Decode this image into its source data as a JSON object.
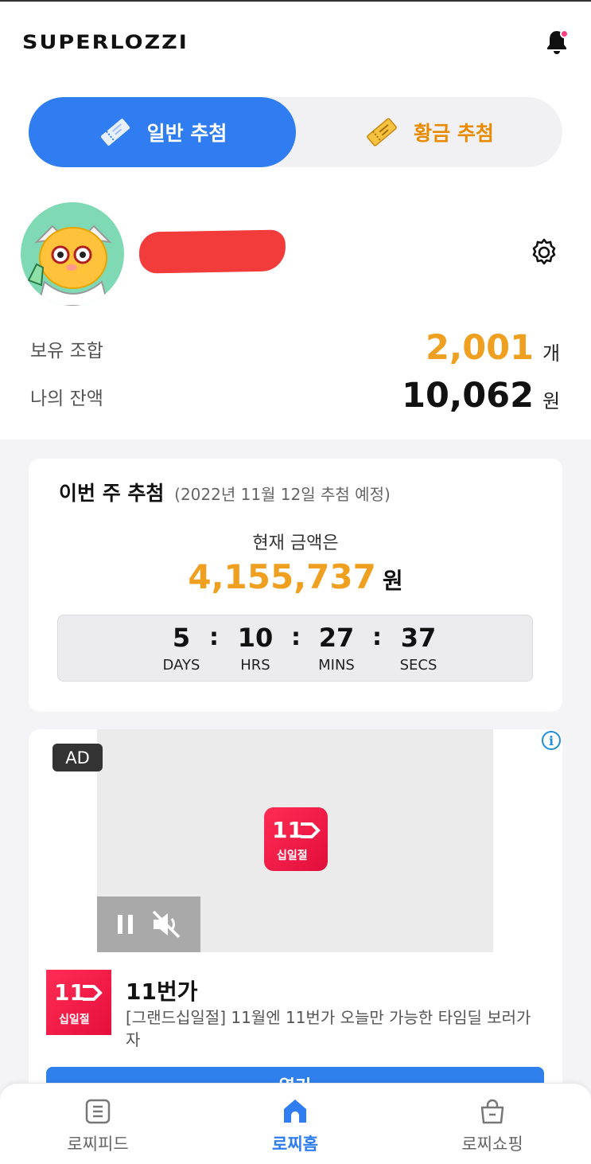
{
  "header": {
    "logo_text": "SUPERLOZZI"
  },
  "tabs": {
    "normal_label": "일반 추첨",
    "gold_label": "황금 추첨"
  },
  "stats": {
    "combos_label": "보유 조합",
    "combos_value": "2,001",
    "combos_unit": "개",
    "balance_label": "나의 잔액",
    "balance_value": "10,062",
    "balance_unit": "원"
  },
  "draw": {
    "title": "이번 주 추첨",
    "subtitle": "(2022년 11월 12일 추첨 예정)",
    "current_label": "현재 금액은",
    "amount": "4,155,737",
    "amount_unit": "원",
    "countdown": {
      "days": "5",
      "days_label": "DAYS",
      "hrs": "10",
      "hrs_label": "HRS",
      "mins": "27",
      "mins_label": "MINS",
      "secs": "37",
      "secs_label": "SECS",
      "separator": ":"
    }
  },
  "ad": {
    "badge": "AD",
    "info": "i",
    "logo_big": "11",
    "logo_sub": "십일절",
    "advertiser": "11번가",
    "description": "[그랜드십일절] 11월엔 11번가 오늘만 가능한 타임딜 보러가자",
    "cta": "열기"
  },
  "nav": {
    "feed": "로찌피드",
    "home": "로찌홈",
    "shop": "로찌쇼핑"
  },
  "colors": {
    "accent": "#2f7df0",
    "gold": "#f0a020",
    "notify": "#ff3d7f"
  }
}
